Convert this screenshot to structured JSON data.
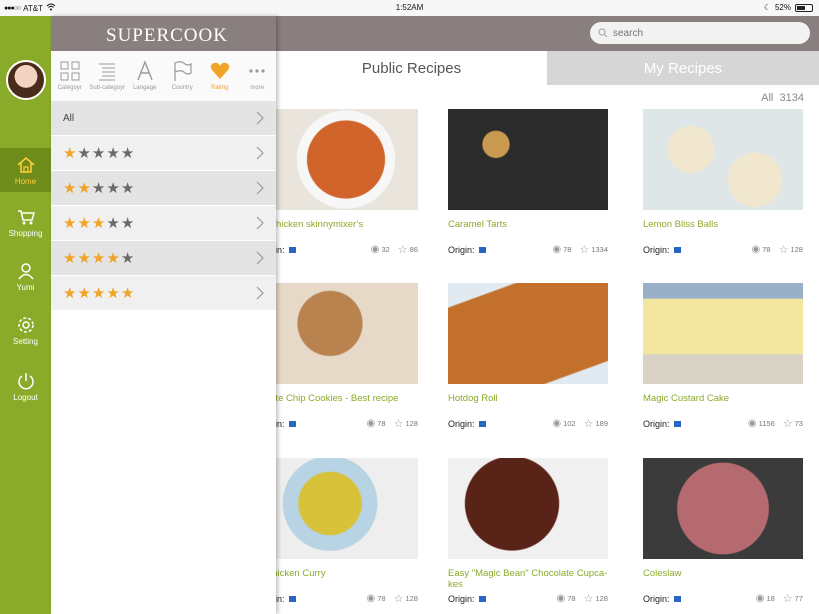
{
  "status": {
    "carrier": "AT&T",
    "time": "1:52AM",
    "battery": "52%"
  },
  "rail": {
    "items": [
      {
        "label": "Home",
        "icon": "home-icon"
      },
      {
        "label": "Shopping",
        "icon": "cart-icon"
      },
      {
        "label": "Yumi",
        "icon": "person-icon"
      },
      {
        "label": "Setting",
        "icon": "gear-icon"
      },
      {
        "label": "Logout",
        "icon": "power-icon"
      }
    ]
  },
  "header": {
    "logo": "SUPERCOOK",
    "search_placeholder": "search"
  },
  "tabs": {
    "public": "Public Recipes",
    "mine": "My Recipes"
  },
  "count": {
    "label": "All",
    "value": "3134"
  },
  "drawer": {
    "filters": [
      {
        "label": "Categoyr",
        "icon": "grid-icon"
      },
      {
        "label": "Sub-categoyr",
        "icon": "list-icon"
      },
      {
        "label": "Langage",
        "icon": "letter-a-icon"
      },
      {
        "label": "Country",
        "icon": "flag-icon"
      },
      {
        "label": "Rating",
        "icon": "heart-icon"
      },
      {
        "label": "more",
        "icon": "more-dots-icon"
      }
    ],
    "all_label": "All",
    "ratings": [
      1,
      2,
      3,
      4,
      5
    ],
    "colors": {
      "star_on": "#f0a325",
      "star_off": "#6a6a6a",
      "accent": "#8aab2a"
    }
  },
  "recipes": [
    {
      "title": "er Chicken skinnymixer’s",
      "origin": "Origin:",
      "views": "32",
      "stars": "86"
    },
    {
      "title": "Caramel Tarts",
      "origin": "Origin:",
      "views": "78",
      "stars": "1334"
    },
    {
      "title": "Lemon Bliss Balls",
      "origin": "Origin:",
      "views": "78",
      "stars": "128"
    },
    {
      "title": "colate Chip Cookies - Best recipe",
      "origin": "Origin:",
      "views": "78",
      "stars": "128"
    },
    {
      "title": "Hotdog Roll",
      "origin": "Origin:",
      "views": "102",
      "stars": "189"
    },
    {
      "title": "Magic Custard Cake",
      "origin": "Origin:",
      "views": "1156",
      "stars": "73"
    },
    {
      "title": "y Chicken Curry",
      "origin": "Origin:",
      "views": "78",
      "stars": "128"
    },
    {
      "title": "Easy \"Magic Bean\" Chocolate Cupca-kes",
      "origin": "Origin:",
      "views": "78",
      "stars": "128"
    },
    {
      "title": "Coleslaw",
      "origin": "Origin:",
      "views": "18",
      "stars": "77"
    }
  ]
}
